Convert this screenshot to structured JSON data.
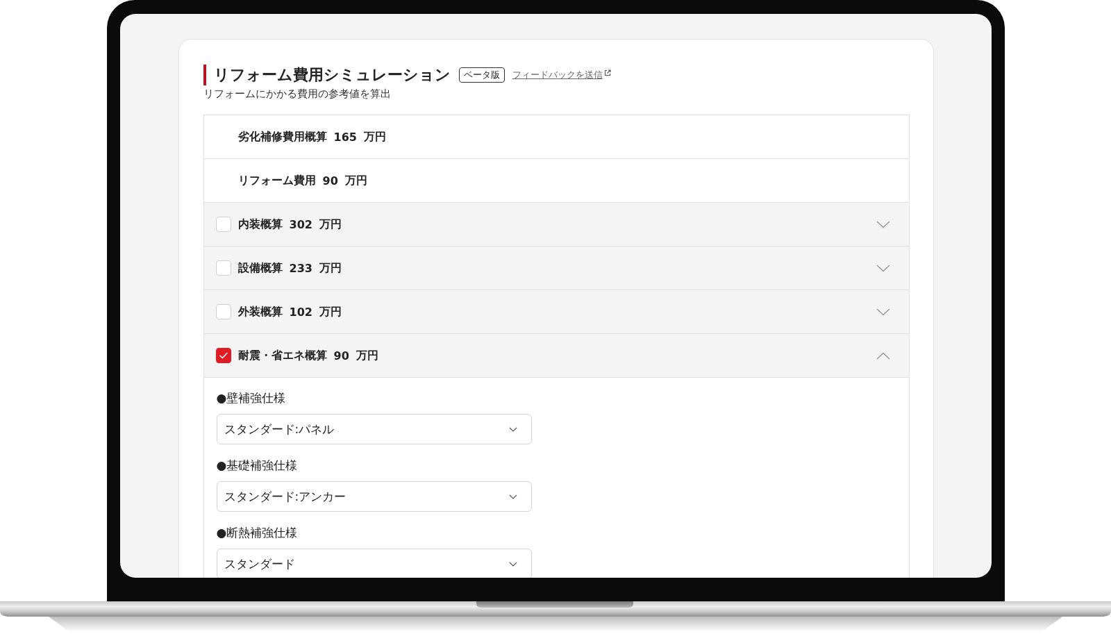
{
  "header": {
    "title": "リフォーム費用シミュレーション",
    "badge": "ベータ版",
    "feedback_link": "フィードバックを送信",
    "subtitle": "リフォームにかかる費用の参考値を算出"
  },
  "cost_rows": [
    {
      "kind": "summary",
      "label": "劣化補修費用概算",
      "amount": "165",
      "unit": "万円"
    },
    {
      "kind": "summary",
      "label": "リフォーム費用",
      "amount": "90",
      "unit": "万円"
    },
    {
      "kind": "category",
      "label": "内装概算",
      "amount": "302",
      "unit": "万円",
      "checked": false,
      "expanded": false
    },
    {
      "kind": "category",
      "label": "設備概算",
      "amount": "233",
      "unit": "万円",
      "checked": false,
      "expanded": false
    },
    {
      "kind": "category",
      "label": "外装概算",
      "amount": "102",
      "unit": "万円",
      "checked": false,
      "expanded": false
    },
    {
      "kind": "category",
      "label": "耐震・省エネ概算",
      "amount": "90",
      "unit": "万円",
      "checked": true,
      "expanded": true,
      "options": [
        {
          "label": "●壁補強仕様",
          "value": "スタンダード:パネル"
        },
        {
          "label": "●基礎補強仕様",
          "value": "スタンダード:アンカー"
        },
        {
          "label": "●断熱補強仕様",
          "value": "スタンダード"
        }
      ]
    }
  ]
}
